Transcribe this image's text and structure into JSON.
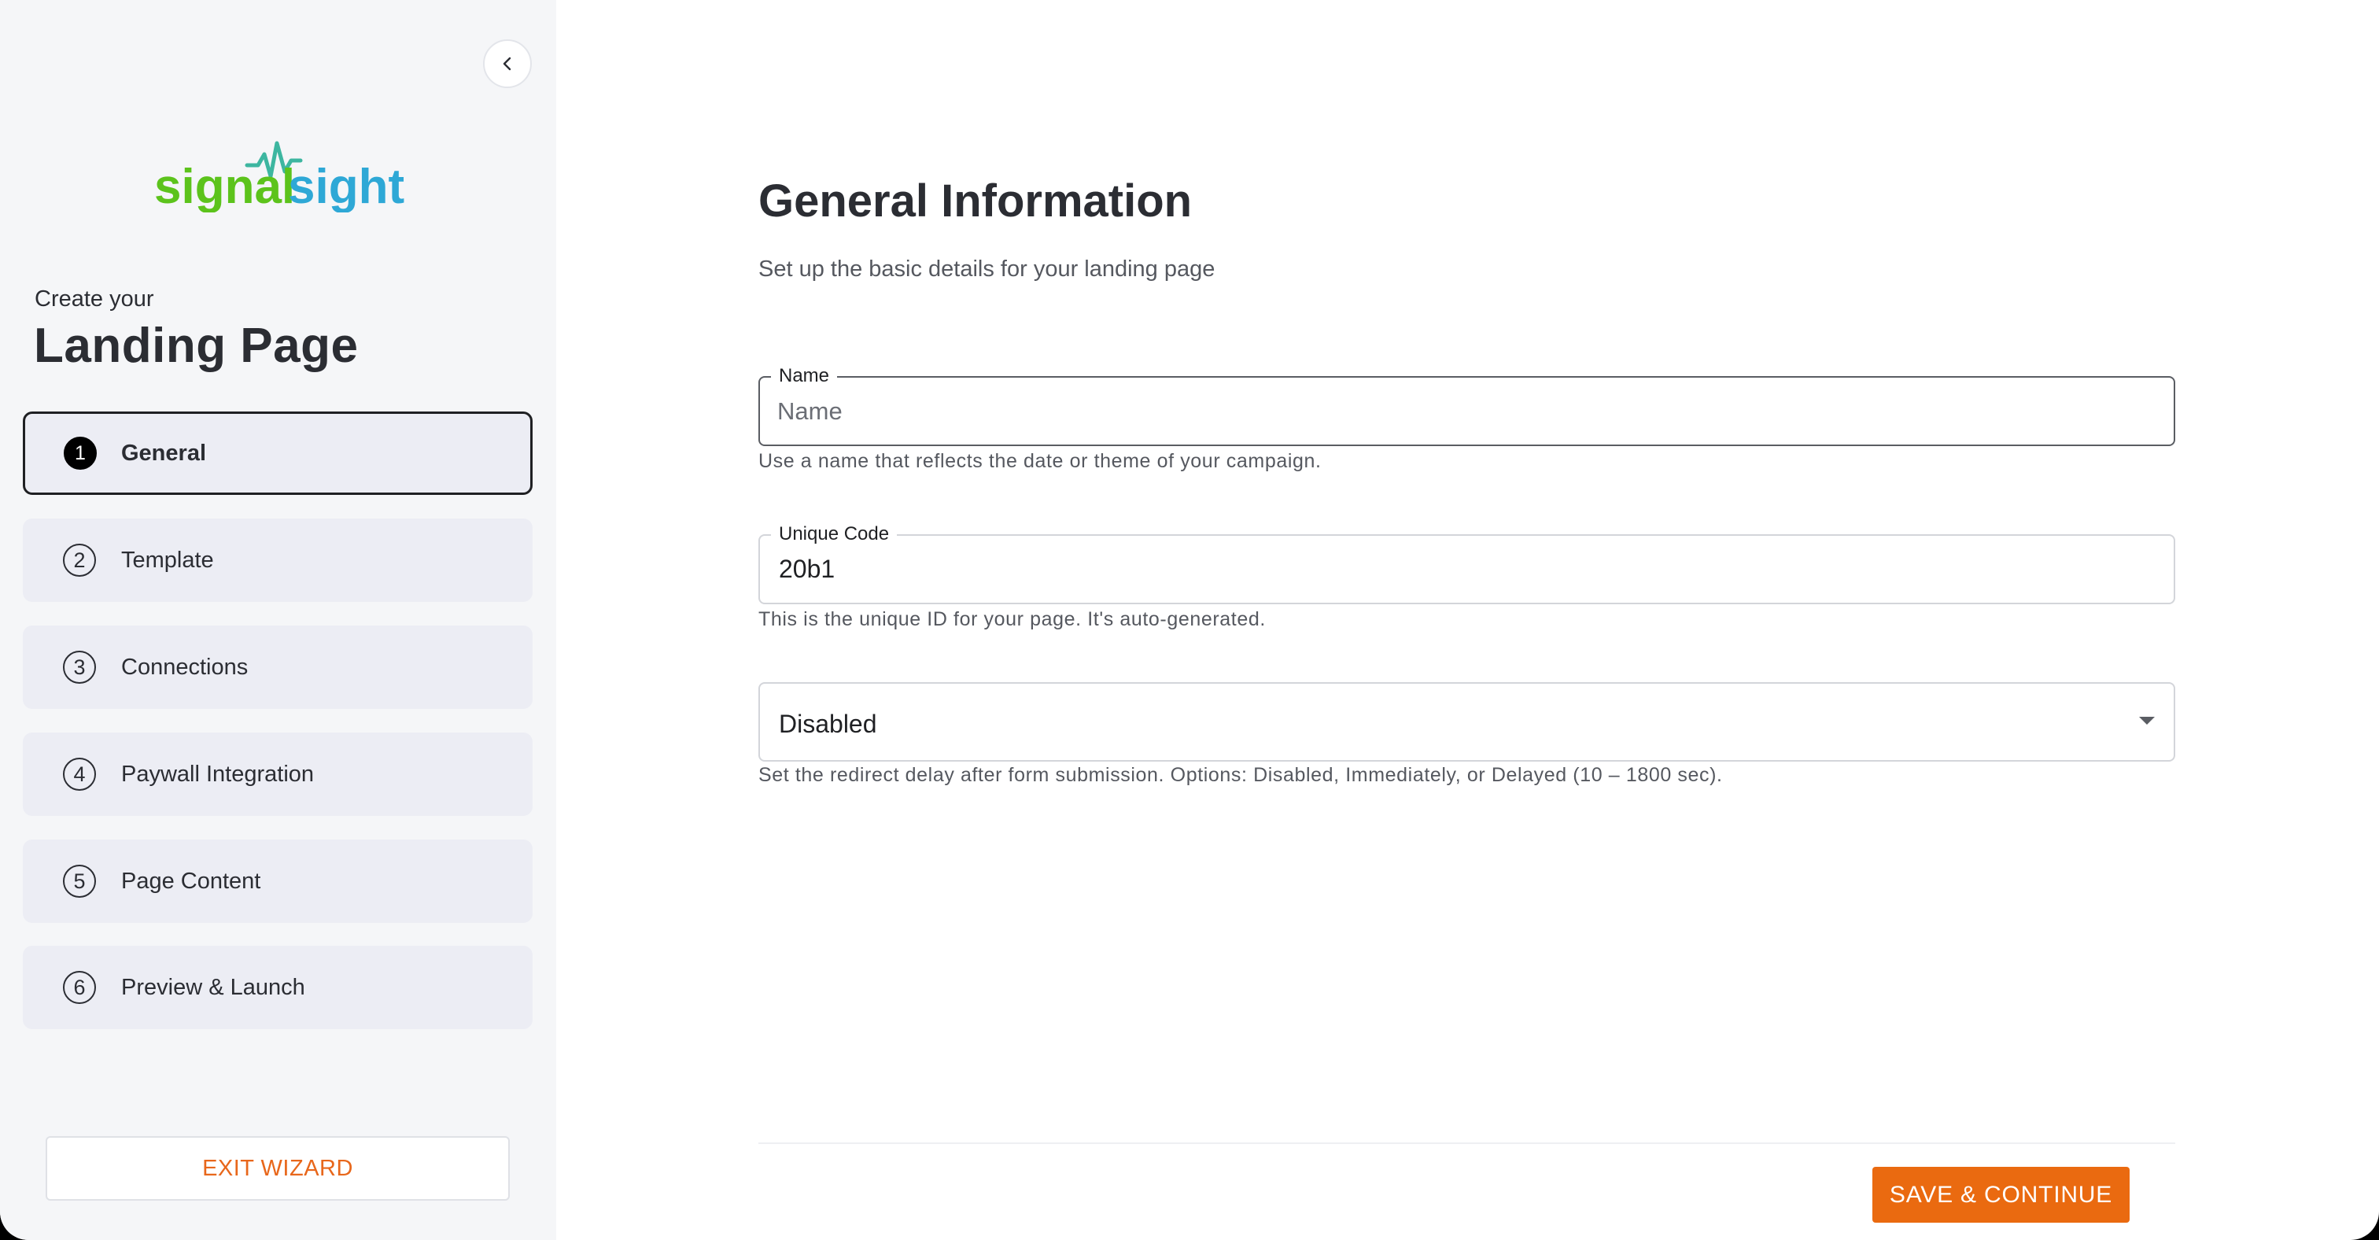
{
  "sidebar": {
    "logo": {
      "part1": "signal",
      "part2": "sight",
      "color1": "#5cc31c",
      "color2": "#2ea8d6"
    },
    "create_your": "Create your",
    "title": "Landing Page",
    "steps": [
      {
        "num": "1",
        "label": "General",
        "active": true
      },
      {
        "num": "2",
        "label": "Template",
        "active": false
      },
      {
        "num": "3",
        "label": "Connections",
        "active": false
      },
      {
        "num": "4",
        "label": "Paywall Integration",
        "active": false
      },
      {
        "num": "5",
        "label": "Page Content",
        "active": false
      },
      {
        "num": "6",
        "label": "Preview & Launch",
        "active": false
      }
    ],
    "exit_label": "EXIT WIZARD",
    "collapse_icon": "chevron-left-icon"
  },
  "main": {
    "title": "General Information",
    "subtitle": "Set up the basic details for your landing page",
    "name_field": {
      "label": "Name",
      "placeholder": "Name",
      "value": "",
      "helper": "Use a name that reflects the date or theme of your campaign."
    },
    "code_field": {
      "label": "Unique Code",
      "value": "20b1",
      "helper": "This is the unique ID for your page. It's auto-generated."
    },
    "redirect_field": {
      "value": "Disabled",
      "helper": "Set the redirect delay after form submission. Options: Disabled, Immediately, or Delayed (10 – 1800 sec)."
    },
    "save_label": "SAVE & CONTINUE"
  },
  "colors": {
    "accent": "#ea6a10",
    "sidebar_bg": "#f5f6f8",
    "step_bg": "#ecedf4"
  }
}
